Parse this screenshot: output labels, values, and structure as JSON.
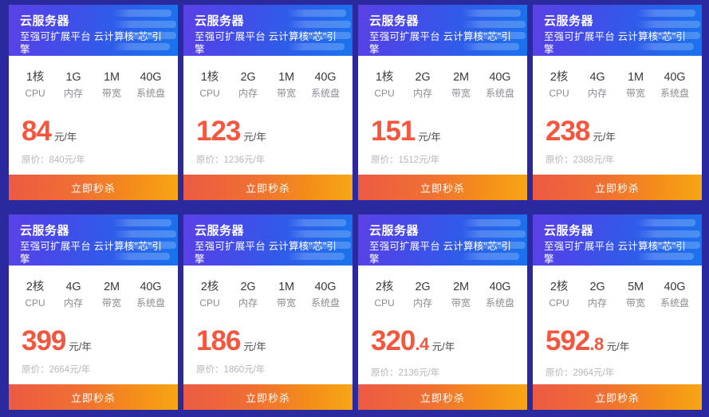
{
  "page": {
    "background_color": "#2a2a9e",
    "card_background": "#ffffff",
    "header_gradient_from": "#5b42e6",
    "header_gradient_to": "#1a73ee",
    "price_color": "#f4573e",
    "button_gradient_from": "#ec5a43",
    "button_gradient_to": "#f7a516"
  },
  "labels": {
    "cpu": "CPU",
    "memory": "内存",
    "bandwidth": "带宽",
    "disk": "系统盘",
    "unit": "元/年",
    "buy": "立即秒杀"
  },
  "cards": [
    {
      "title": "云服务器",
      "subtitle": "至强可扩展平台 云计算核\"芯\"引擎",
      "cpu": "1核",
      "memory": "1G",
      "bandwidth": "1M",
      "disk": "40G",
      "price_main": "84",
      "price_frac": "",
      "unit": "元/年",
      "original": "原价：840元/年",
      "buy": "立即秒杀"
    },
    {
      "title": "云服务器",
      "subtitle": "至强可扩展平台 云计算核\"芯\"引擎",
      "cpu": "1核",
      "memory": "2G",
      "bandwidth": "1M",
      "disk": "40G",
      "price_main": "123",
      "price_frac": "",
      "unit": "元/年",
      "original": "原价：1236元/年",
      "buy": "立即秒杀"
    },
    {
      "title": "云服务器",
      "subtitle": "至强可扩展平台 云计算核\"芯\"引擎",
      "cpu": "1核",
      "memory": "2G",
      "bandwidth": "2M",
      "disk": "40G",
      "price_main": "151",
      "price_frac": "",
      "unit": "元/年",
      "original": "原价：1512元/年",
      "buy": "立即秒杀"
    },
    {
      "title": "云服务器",
      "subtitle": "至强可扩展平台 云计算核\"芯\"引擎",
      "cpu": "2核",
      "memory": "4G",
      "bandwidth": "1M",
      "disk": "40G",
      "price_main": "238",
      "price_frac": "",
      "unit": "元/年",
      "original": "原价：2388元/年",
      "buy": "立即秒杀"
    },
    {
      "title": "云服务器",
      "subtitle": "至强可扩展平台 云计算核\"芯\"引擎",
      "cpu": "2核",
      "memory": "4G",
      "bandwidth": "2M",
      "disk": "40G",
      "price_main": "399",
      "price_frac": "",
      "unit": "元/年",
      "original": "原价：2664元/年",
      "buy": "立即秒杀"
    },
    {
      "title": "云服务器",
      "subtitle": "至强可扩展平台 云计算核\"芯\"引擎",
      "cpu": "2核",
      "memory": "2G",
      "bandwidth": "1M",
      "disk": "40G",
      "price_main": "186",
      "price_frac": "",
      "unit": "元/年",
      "original": "原价：1860元/年",
      "buy": "立即秒杀"
    },
    {
      "title": "云服务器",
      "subtitle": "至强可扩展平台 云计算核\"芯\"引擎",
      "cpu": "2核",
      "memory": "2G",
      "bandwidth": "2M",
      "disk": "40G",
      "price_main": "320",
      "price_frac": ".4",
      "unit": "元/年",
      "original": "原价：2136元/年",
      "buy": "立即秒杀"
    },
    {
      "title": "云服务器",
      "subtitle": "至强可扩展平台 云计算核\"芯\"引擎",
      "cpu": "2核",
      "memory": "2G",
      "bandwidth": "5M",
      "disk": "40G",
      "price_main": "592",
      "price_frac": ".8",
      "unit": "元/年",
      "original": "原价：2964元/年",
      "buy": "立即秒杀"
    }
  ]
}
